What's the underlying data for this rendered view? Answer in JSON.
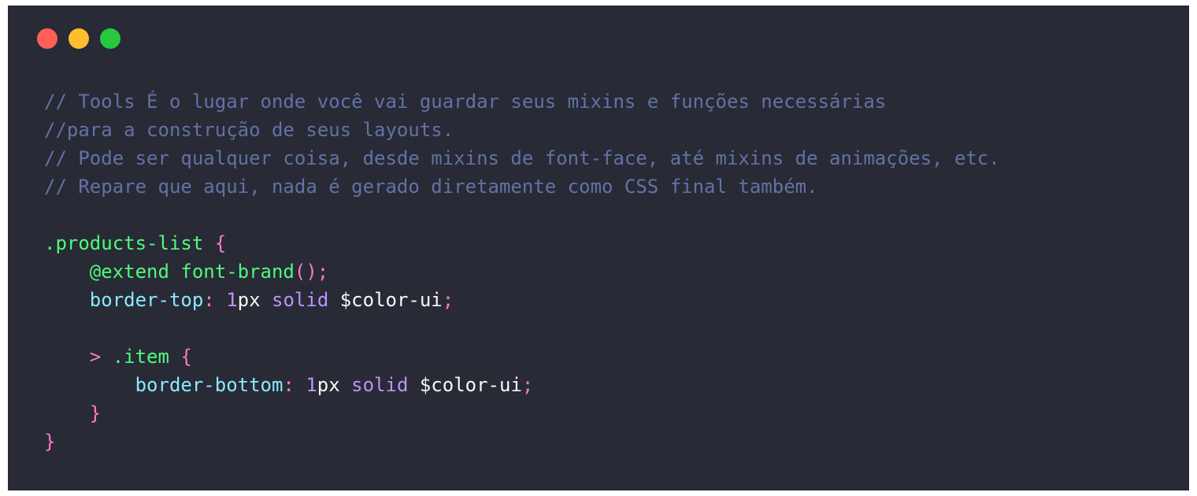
{
  "window": {
    "background": "#282a36",
    "controls": [
      {
        "name": "close",
        "color": "#ff5f56"
      },
      {
        "name": "minimize",
        "color": "#ffbd2e"
      },
      {
        "name": "maximize",
        "color": "#27c93f"
      }
    ]
  },
  "colors": {
    "comment": "#6272a4",
    "selector": "#50fa7b",
    "brace": "#ff79c6",
    "property": "#8be9fd",
    "number": "#bd93f9",
    "keyword": "#bd93f9",
    "text": "#f8f8f2"
  },
  "code": {
    "lines": [
      [
        {
          "t": "// Tools É o lugar onde você vai guardar seus mixins e funções necessárias",
          "k": "comment"
        }
      ],
      [
        {
          "t": "//para a construção de seus layouts.",
          "k": "comment"
        }
      ],
      [
        {
          "t": "// Pode ser qualquer coisa, desde mixins de font-face, até mixins de animações, etc.",
          "k": "comment"
        }
      ],
      [
        {
          "t": "// Repare que aqui, nada é gerado diretamente como CSS final também.",
          "k": "comment"
        }
      ],
      [],
      [
        {
          "t": ".products-list ",
          "k": "selector"
        },
        {
          "t": "{",
          "k": "brace"
        }
      ],
      [
        {
          "t": "    ",
          "k": "text"
        },
        {
          "t": "@extend font-brand",
          "k": "selector"
        },
        {
          "t": "()",
          "k": "brace"
        },
        {
          "t": ";",
          "k": "brace"
        }
      ],
      [
        {
          "t": "    ",
          "k": "text"
        },
        {
          "t": "border-top",
          "k": "property"
        },
        {
          "t": ": ",
          "k": "brace"
        },
        {
          "t": "1",
          "k": "number"
        },
        {
          "t": "px ",
          "k": "text"
        },
        {
          "t": "solid",
          "k": "keyword"
        },
        {
          "t": " $color-ui",
          "k": "text"
        },
        {
          "t": ";",
          "k": "brace"
        }
      ],
      [],
      [
        {
          "t": "    ",
          "k": "text"
        },
        {
          "t": "> ",
          "k": "brace"
        },
        {
          "t": ".item ",
          "k": "selector"
        },
        {
          "t": "{",
          "k": "brace"
        }
      ],
      [
        {
          "t": "        ",
          "k": "text"
        },
        {
          "t": "border-bottom",
          "k": "property"
        },
        {
          "t": ": ",
          "k": "brace"
        },
        {
          "t": "1",
          "k": "number"
        },
        {
          "t": "px ",
          "k": "text"
        },
        {
          "t": "solid",
          "k": "keyword"
        },
        {
          "t": " $color-ui",
          "k": "text"
        },
        {
          "t": ";",
          "k": "brace"
        }
      ],
      [
        {
          "t": "    ",
          "k": "text"
        },
        {
          "t": "}",
          "k": "brace"
        }
      ],
      [
        {
          "t": "}",
          "k": "brace"
        }
      ]
    ]
  }
}
